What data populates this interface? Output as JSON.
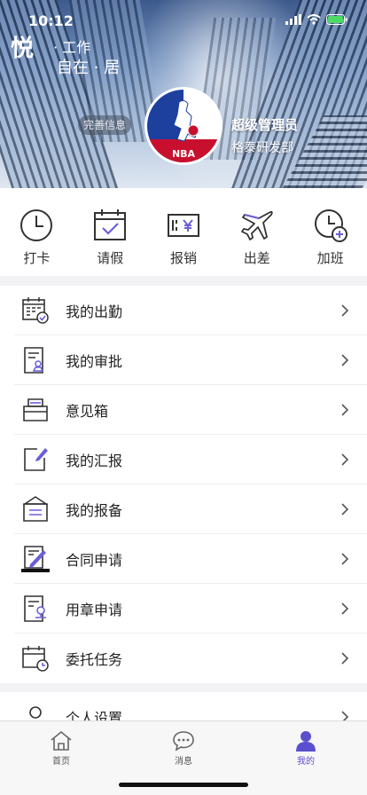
{
  "status": {
    "time": "10:12"
  },
  "brand": {
    "big": "悦",
    "line1": "· 工作",
    "line2": "自在 · 居"
  },
  "profile": {
    "edit_label": "完善信息",
    "name": "超级管理员",
    "department": "格泰研发部",
    "avatar_text": "NBA"
  },
  "quick_actions": [
    {
      "label": "打卡",
      "icon": "clock-icon"
    },
    {
      "label": "请假",
      "icon": "calendar-check-icon"
    },
    {
      "label": "报销",
      "icon": "receipt-yen-icon"
    },
    {
      "label": "出差",
      "icon": "airplane-icon"
    },
    {
      "label": "加班",
      "icon": "clock-plus-icon"
    }
  ],
  "menu": [
    {
      "label": "我的出勤",
      "icon": "attendance-calendar-icon"
    },
    {
      "label": "我的审批",
      "icon": "approval-document-icon"
    },
    {
      "label": "意见箱",
      "icon": "suggestion-box-icon"
    },
    {
      "label": "我的汇报",
      "icon": "report-edit-icon"
    },
    {
      "label": "我的报备",
      "icon": "filing-tray-icon"
    },
    {
      "label": "合同申请",
      "icon": "contract-sign-icon"
    },
    {
      "label": "用章申请",
      "icon": "seal-request-icon"
    },
    {
      "label": "委托任务",
      "icon": "delegate-task-icon"
    }
  ],
  "menu2": [
    {
      "label": "个人设置",
      "icon": "user-settings-icon"
    }
  ],
  "tabs": [
    {
      "label": "首页",
      "icon": "home-icon"
    },
    {
      "label": "消息",
      "icon": "message-icon"
    },
    {
      "label": "我的",
      "icon": "profile-icon",
      "active": true
    }
  ],
  "colors": {
    "accent": "#5b4fcf",
    "icon_stroke": "#333333",
    "icon_accent": "#6a5fd8"
  }
}
